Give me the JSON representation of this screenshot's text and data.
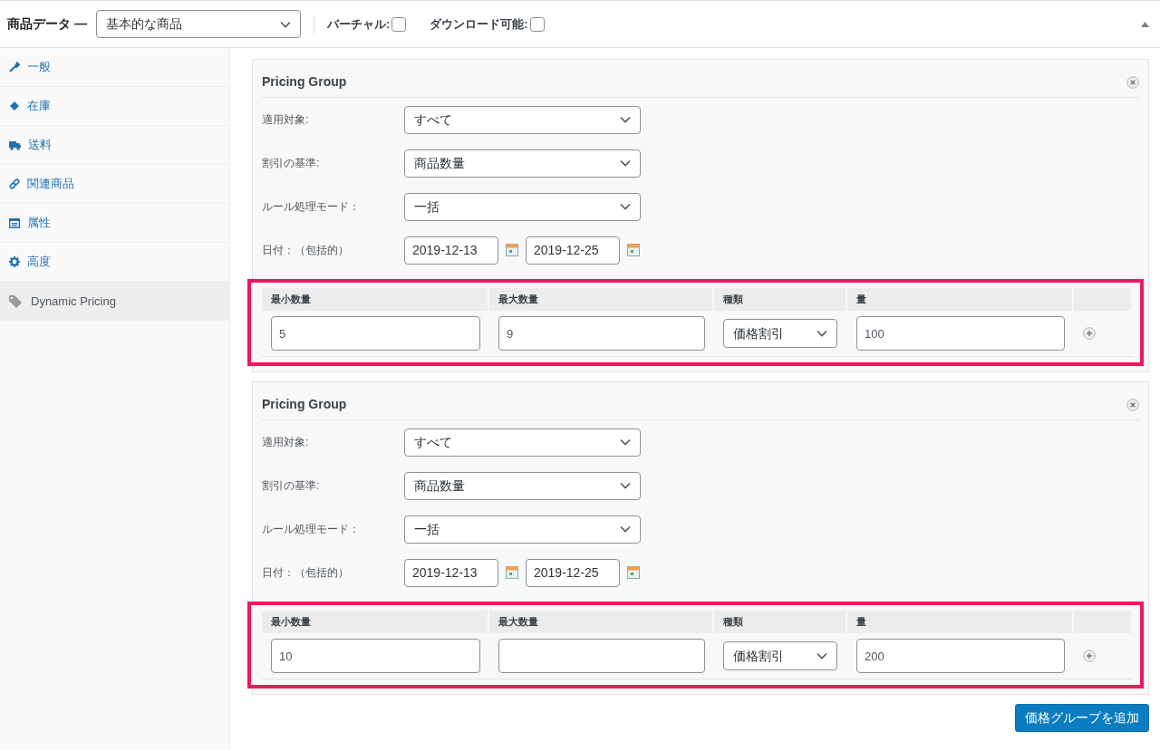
{
  "header": {
    "title": "商品データ —",
    "product_type": "基本的な商品",
    "options": [
      {
        "label": "バーチャル:",
        "checked": false
      },
      {
        "label": "ダウンロード可能:",
        "checked": false
      }
    ]
  },
  "sidebar": {
    "items": [
      {
        "label": "一般",
        "selected": false
      },
      {
        "label": "在庫",
        "selected": false
      },
      {
        "label": "送料",
        "selected": false
      },
      {
        "label": "関連商品",
        "selected": false
      },
      {
        "label": "属性",
        "selected": false
      },
      {
        "label": "高度",
        "selected": false
      },
      {
        "label": "Dynamic Pricing",
        "selected": true
      }
    ]
  },
  "groups": [
    {
      "title": "Pricing Group",
      "fields": [
        {
          "label": "適用対象:",
          "value": "すべて"
        },
        {
          "label": "割引の基準:",
          "value": "商品数量"
        },
        {
          "label": "ルール処理モード：",
          "value": "一括"
        }
      ],
      "date_label": "日付：（包括的）",
      "date_from": "2019-12-13",
      "date_to": "2019-12-25",
      "rule_columns": [
        "最小数量",
        "最大数量",
        "種類",
        "量"
      ],
      "rules": [
        {
          "min": "5",
          "max": "9",
          "type": "価格割引",
          "amount": "100"
        }
      ]
    },
    {
      "title": "Pricing Group",
      "fields": [
        {
          "label": "適用対象:",
          "value": "すべて"
        },
        {
          "label": "割引の基準:",
          "value": "商品数量"
        },
        {
          "label": "ルール処理モード：",
          "value": "一括"
        }
      ],
      "date_label": "日付：（包括的）",
      "date_from": "2019-12-13",
      "date_to": "2019-12-25",
      "rule_columns": [
        "最小数量",
        "最大数量",
        "種類",
        "量"
      ],
      "rules": [
        {
          "min": "10",
          "type": "価格割引",
          "amount": "200"
        }
      ]
    }
  ],
  "add_button": "価格グループを追加"
}
